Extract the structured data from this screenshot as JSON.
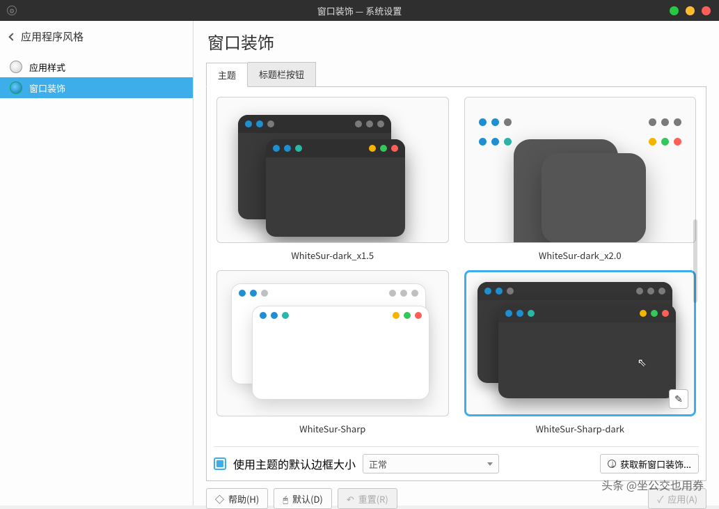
{
  "window": {
    "title": "窗口装饰 — 系统设置"
  },
  "sidebar": {
    "back_label": "应用程序风格",
    "items": [
      {
        "label": "应用样式"
      },
      {
        "label": "窗口装饰"
      }
    ]
  },
  "main": {
    "page_title": "窗口装饰",
    "tabs": [
      {
        "label": "主题"
      },
      {
        "label": "标题栏按钮"
      }
    ],
    "themes": [
      {
        "name": "WhiteSur-dark_x1.5"
      },
      {
        "name": "WhiteSur-dark_x2.0"
      },
      {
        "name": "WhiteSur-Sharp"
      },
      {
        "name": "WhiteSur-Sharp-dark"
      }
    ],
    "selected_theme_index": 3,
    "options": {
      "use_theme_border_label": "使用主题的默认边框大小",
      "border_size_value": "正常"
    },
    "get_new_label": "获取新窗口装饰..."
  },
  "footer": {
    "help": "帮助(H)",
    "defaults": "默认(D)",
    "reset": "重置(R)",
    "apply": "应用(A)"
  },
  "watermark": "头条 @坐公交也用券"
}
